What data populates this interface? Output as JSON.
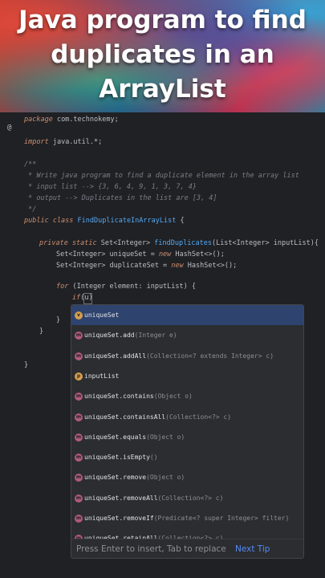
{
  "banner": {
    "title": "Java program to find duplicates in an ArrayList"
  },
  "code": {
    "l1": [
      "package",
      " com.technokemy;"
    ],
    "l2": [
      "import",
      " java.util.*;"
    ],
    "l3": "/**",
    "l4": " * Write java program to find a duplicate element in the array list",
    "l5": " * input list --> {3, 6, 4, 9, 1, 3, 7, 4}",
    "l6": " * output --> Duplicates in the list are [3, 4]",
    "l7": " */",
    "l8": [
      "public class ",
      "FindDuplicateInArrayList",
      " {"
    ],
    "l9": [
      "private static ",
      "Set<Integer> ",
      "findDuplicates",
      "(List<Integer> inputList){"
    ],
    "l10": [
      "Set<Integer> uniqueSet = ",
      "new",
      " HashSet<>();"
    ],
    "l11": [
      "Set<Integer> duplicateSet = ",
      "new",
      " HashSet<>();"
    ],
    "l12": [
      "for",
      " (Integer element: inputList) {"
    ],
    "l13": [
      "if",
      "(u)"
    ],
    "l14": "}",
    "l15": "}",
    "l16": "}",
    "gutter_mark": "@"
  },
  "completion": {
    "items": [
      {
        "icon": "v",
        "name": "uniqueSet",
        "sig": ""
      },
      {
        "icon": "m",
        "name": "uniqueSet.add",
        "sig": "(Integer e)"
      },
      {
        "icon": "m",
        "name": "uniqueSet.addAll",
        "sig": "(Collection<? extends Integer> c)"
      },
      {
        "icon": "p",
        "name": "inputList",
        "sig": ""
      },
      {
        "icon": "m",
        "name": "uniqueSet.contains",
        "sig": "(Object o)"
      },
      {
        "icon": "m",
        "name": "uniqueSet.containsAll",
        "sig": "(Collection<?> c)"
      },
      {
        "icon": "m",
        "name": "uniqueSet.equals",
        "sig": "(Object o)"
      },
      {
        "icon": "m",
        "name": "uniqueSet.isEmpty",
        "sig": "()"
      },
      {
        "icon": "m",
        "name": "uniqueSet.remove",
        "sig": "(Object o)"
      },
      {
        "icon": "m",
        "name": "uniqueSet.removeAll",
        "sig": "(Collection<?> c)"
      },
      {
        "icon": "m",
        "name": "uniqueSet.removeIf",
        "sig": "(Predicate<? super Integer> filter)"
      },
      {
        "icon": "m",
        "name": "uniqueSet.retainAll",
        "sig": "(Collection<?> c)"
      }
    ],
    "hint": "Press Enter to insert, Tab to replace",
    "hint_link": "Next Tip"
  },
  "colors": {
    "accent": "#548af7",
    "background": "#1f2125",
    "popup": "#2b2d30",
    "selection": "#2e436e"
  }
}
